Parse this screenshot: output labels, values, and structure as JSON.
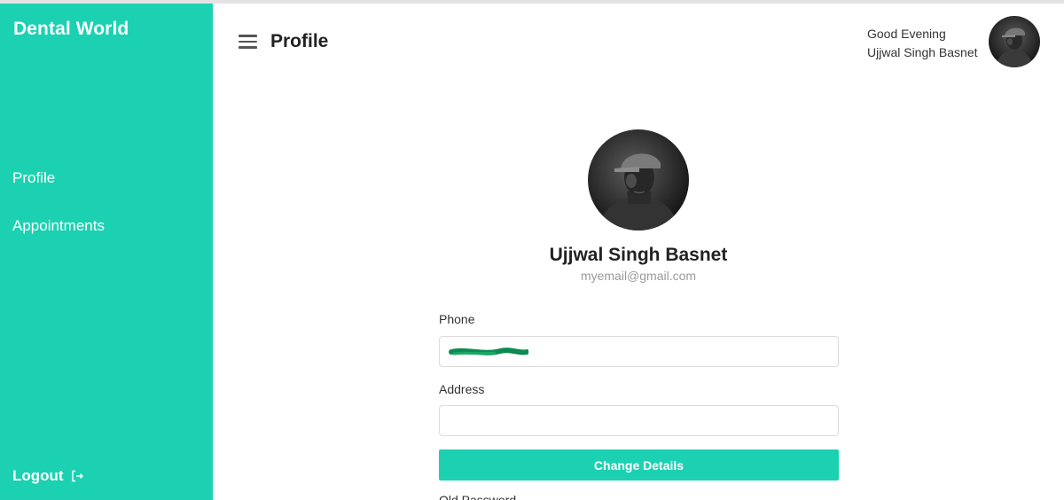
{
  "sidebar": {
    "brand": "Dental World",
    "items": [
      {
        "label": "Profile"
      },
      {
        "label": "Appointments"
      }
    ],
    "logout_label": "Logout",
    "background": "#1bd1b2"
  },
  "header": {
    "title": "Profile",
    "greeting": "Good Evening",
    "user_name": "Ujjwal Singh Basnet"
  },
  "profile": {
    "name": "Ujjwal Singh Basnet",
    "email": "myemail@gmail.com"
  },
  "form": {
    "phone_label": "Phone",
    "address_label": "Address",
    "address_value": "",
    "submit_label": "Change Details",
    "next_label": "Old Password",
    "accent": "#1bd1b2"
  },
  "icons": {
    "menu": "menu-icon",
    "logout": "logout-icon",
    "avatar": "user-avatar"
  }
}
